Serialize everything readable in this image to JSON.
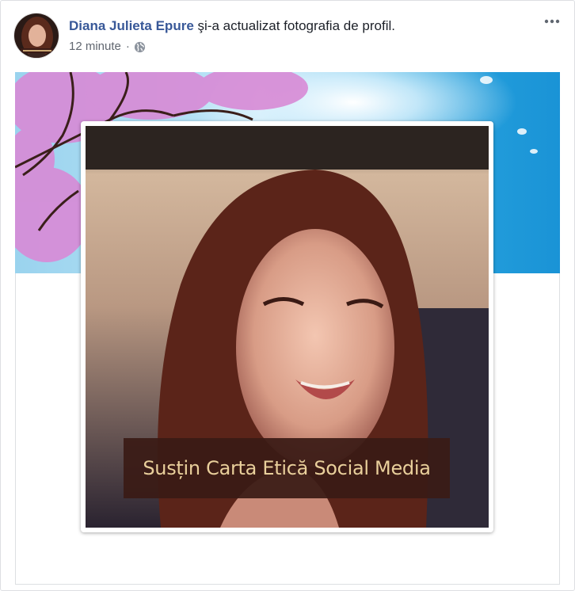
{
  "post": {
    "author_name": "Diana Julieta Epure",
    "action_text": " şi-a actualizat fotografia de profil.",
    "time": "12 minute",
    "separator": "·",
    "privacy_icon": "globe-icon",
    "more_icon": "more-horizontal-icon"
  },
  "profile_photo": {
    "frame_caption": "Susțin Carta Etică Social Media"
  },
  "colors": {
    "author_link": "#385898",
    "secondary_text": "#616770",
    "caption_band": "#3a1b16",
    "caption_text": "#e9cf9b",
    "sky": "#1f9fdc",
    "blossom": "#d78ad8"
  }
}
